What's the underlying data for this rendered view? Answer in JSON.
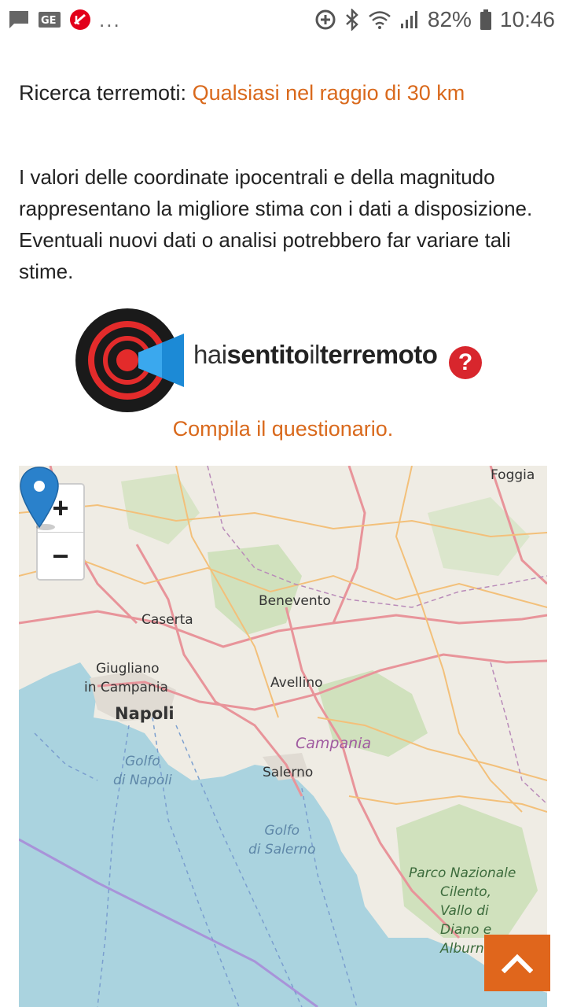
{
  "status_bar": {
    "dots": "...",
    "battery_percent": "82%",
    "time": "10:46",
    "icons": [
      "message-icon",
      "ge-icon",
      "unicredit-icon",
      "data-saver-icon",
      "bluetooth-icon",
      "wifi-icon",
      "signal-icon",
      "battery-icon"
    ],
    "ge_label": "GE"
  },
  "search": {
    "label": "Ricerca terremoti:",
    "value": "Qualsiasi nel raggio di 30 km"
  },
  "info_text": "I valori delle coordinate ipocentrali e della magnitudo rappresentano la migliore stima con i dati a disposizione. Eventuali nuovi dati o analisi potrebbero far variare tali stime.",
  "logo": {
    "part1": "hai",
    "part2": "sentito",
    "part3": "il",
    "part4": "terremoto",
    "q": "?"
  },
  "questionnaire_link": "Compila il questionario.",
  "map": {
    "zoom_in": "+",
    "zoom_out": "−",
    "labels": {
      "foggia": "Foggia",
      "benevento": "Benevento",
      "caserta": "Caserta",
      "giugliano_1": "Giugliano",
      "giugliano_2": "in Campania",
      "napoli": "Napoli",
      "avellino": "Avellino",
      "campania": "Campania",
      "golfo_napoli_1": "Golfo",
      "golfo_napoli_2": "di Napoli",
      "salerno": "Salerno",
      "golfo_salerno_1": "Golfo",
      "golfo_salerno_2": "di Salerno",
      "parco_1": "Parco Nazionale",
      "parco_2": "Cilento,",
      "parco_3": "Vallo di",
      "parco_4": "Diano e",
      "parco_5": "Alburni"
    },
    "colors": {
      "land": "#efece4",
      "sea": "#aad3df",
      "forest": "#c8dfb3",
      "road_major": "#e8949a",
      "road_minor": "#f3c07a",
      "marker": "#2a81cb"
    }
  },
  "scroll_top_icon": "chevron-up-icon",
  "accent_color": "#d9691c"
}
